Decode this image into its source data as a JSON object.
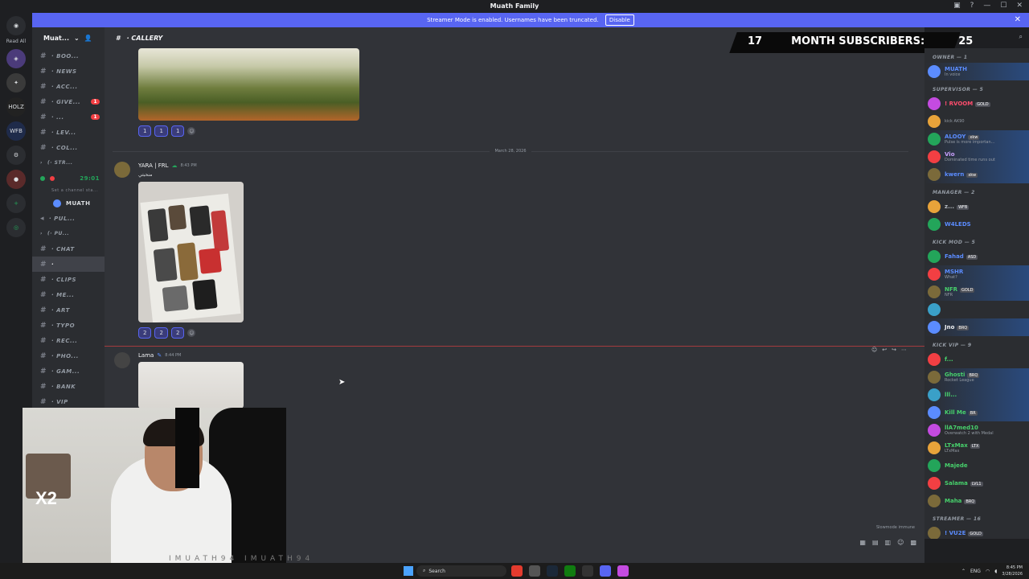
{
  "titlebar": {
    "title": "Muath Family"
  },
  "banner": {
    "text": "Streamer Mode is enabled. Usernames have been truncated.",
    "disable_label": "Disable"
  },
  "servers": {
    "read_all": "Read All",
    "items": [
      "HOLZ",
      "WFB"
    ]
  },
  "guild": {
    "name": "Muat..."
  },
  "channels": [
    {
      "label": "· BOO...",
      "active": false
    },
    {
      "label": "· NEWS",
      "active": false
    },
    {
      "label": "· ACC...",
      "active": false
    },
    {
      "label": "· GIVE...",
      "active": false,
      "badge": "1"
    },
    {
      "label": "· ...",
      "active": false,
      "badge": "1"
    },
    {
      "label": "· LEV...",
      "active": false
    },
    {
      "label": "· COL...",
      "active": false
    }
  ],
  "voice": {
    "category": "(· STR...",
    "channel": "29:01",
    "status": "Set a channel sta...",
    "user": "MUATH",
    "pul": "· PUL...",
    "category2": "(· PU..."
  },
  "channels2": [
    {
      "label": "· CHAT",
      "active": false
    },
    {
      "label": "·",
      "active": true
    },
    {
      "label": "· CLIPS",
      "active": false
    },
    {
      "label": "· ME...",
      "active": false
    },
    {
      "label": "· ART",
      "active": false
    },
    {
      "label": "· TYPO",
      "active": false
    },
    {
      "label": "· REC...",
      "active": false
    },
    {
      "label": "· PHO...",
      "active": false
    },
    {
      "label": "· GAM...",
      "active": false
    },
    {
      "label": "· BANK",
      "active": false
    },
    {
      "label": "· VIP",
      "active": false
    }
  ],
  "header": {
    "channel": "· CALLERY"
  },
  "messages": {
    "reacts1": [
      "1",
      "1",
      "1"
    ],
    "date_divider": "March 28, 2026",
    "msg2": {
      "author": "YARA | FRL",
      "time": "8:43 PM",
      "text": "منحبتي"
    },
    "reacts2": [
      "2",
      "2",
      "2"
    ],
    "msg3": {
      "author": "Lama",
      "time": "8:44 PM"
    },
    "slowmode": "Slowmode immune"
  },
  "overlay": {
    "left": "17",
    "middle": "MONTH SUBSCRIBERS:",
    "right": "25"
  },
  "members": {
    "roles": [
      {
        "label": "OWNER — 1",
        "members": [
          {
            "name": "MUATH",
            "color": "#5b8cff",
            "status": "In voice",
            "hl": true
          }
        ]
      },
      {
        "label": "SUPERVISOR — 5",
        "members": [
          {
            "name": "! RVOOM",
            "color": "#ff4d6d",
            "tag": "GOLD",
            "status": "",
            "hl": false
          },
          {
            "name": "",
            "color": "#b5bac1",
            "status": "kick AK90",
            "hl": false
          },
          {
            "name": "ALOOY",
            "color": "#5b8cff",
            "tag": "xkw",
            "status": "Pulse is more importan...",
            "hl": true
          },
          {
            "name": "Vio",
            "color": "#c9a0ff",
            "status": "Dominated time runs out",
            "hl": true
          },
          {
            "name": "kwern",
            "color": "#5b8cff",
            "tag": "xkw",
            "status": "",
            "hl": true
          }
        ]
      },
      {
        "label": "MANAGER — 2",
        "members": [
          {
            "name": "z...",
            "color": "#b5bac1",
            "tag": "WFB",
            "status": "",
            "hl": false
          },
          {
            "name": "W4LEDS",
            "color": "#5b8cff",
            "status": "",
            "hl": false
          }
        ]
      },
      {
        "label": "KICK MOD — 5",
        "members": [
          {
            "name": "Fahad",
            "color": "#5b8cff",
            "tag": "ASD",
            "status": "",
            "hl": false
          },
          {
            "name": "MSHR",
            "color": "#5b8cff",
            "status": "What?",
            "hl": true
          },
          {
            "name": "NFR",
            "color": "#47d16c",
            "tag": "GOLD",
            "status": "NFR",
            "hl": true
          },
          {
            "name": "",
            "color": "#b5bac1",
            "status": "",
            "hl": false
          },
          {
            "name": "Jno",
            "color": "#f2f3f5",
            "tag": "BRQ",
            "status": "",
            "hl": true
          }
        ]
      },
      {
        "label": "KICK VIP — 9",
        "members": [
          {
            "name": "f...",
            "color": "#47d16c",
            "status": "",
            "hl": false
          },
          {
            "name": "Ghosti",
            "color": "#47d16c",
            "tag": "BRQ",
            "status": "Rocket League",
            "hl": true
          },
          {
            "name": "lll...",
            "color": "#47d16c",
            "status": "",
            "hl": true
          },
          {
            "name": "Kill Me",
            "color": "#47d16c",
            "tag": "BR",
            "status": "",
            "hl": true
          },
          {
            "name": "llA7med10",
            "color": "#47d16c",
            "status": "Overwatch 2 with Medal",
            "hl": false
          },
          {
            "name": "LTxMax",
            "color": "#47d16c",
            "tag": "LTX",
            "status": "LTxMax",
            "hl": false
          },
          {
            "name": "Majede",
            "color": "#47d16c",
            "status": "",
            "hl": false
          },
          {
            "name": "Salama",
            "color": "#47d16c",
            "tag": "LVL1",
            "status": "",
            "hl": false
          },
          {
            "name": "Maha",
            "color": "#47d16c",
            "tag": "BRQ",
            "status": "",
            "hl": false
          }
        ]
      },
      {
        "label": "STREAMER — 16",
        "members": [
          {
            "name": "! VU2E",
            "color": "#5b8cff",
            "tag": "GOLD",
            "status": "",
            "hl": false
          }
        ]
      }
    ]
  },
  "webcam": {
    "badge": "X2",
    "handle": "IMUATH94  IMUATH94"
  },
  "taskbar": {
    "search": "Search",
    "lang": "ENG",
    "time": "8:45 PM",
    "date": "3/28/2026"
  },
  "colors": {
    "accent": "#5865f2",
    "bg": "#313338",
    "sidebar": "#2b2d31"
  }
}
